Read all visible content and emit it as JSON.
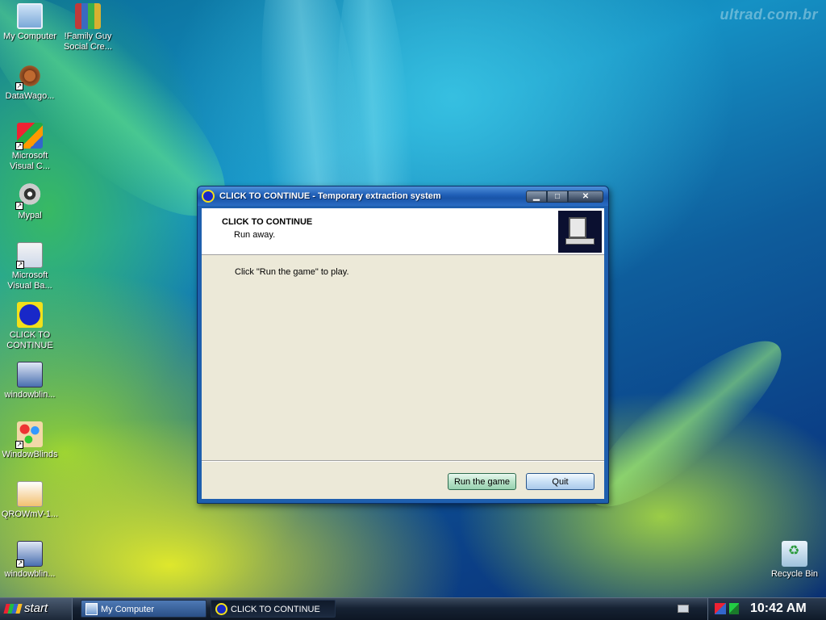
{
  "desktop": {
    "watermark": "ultrad.com.br",
    "icons": [
      {
        "label": "My Computer",
        "icon": "computer-icon"
      },
      {
        "label": "!Family Guy Social Cre...",
        "icon": "winrar-archive-icon"
      },
      {
        "label": "DataWago...",
        "icon": "gear-icon"
      },
      {
        "label": "Microsoft Visual C...",
        "icon": "visual-c-icon"
      },
      {
        "label": "Mypal",
        "icon": "raccoon-browser-icon"
      },
      {
        "label": "Microsoft Visual Ba...",
        "icon": "visual-basic-icon"
      },
      {
        "label": "CLICK TO CONTINUE",
        "icon": "click-to-continue-icon"
      },
      {
        "label": "windowblin...",
        "icon": "windowblinds-installer-icon"
      },
      {
        "label": "WindowBlinds",
        "icon": "paint-palette-icon"
      },
      {
        "label": "QROWmV-1...",
        "icon": "image-file-icon"
      },
      {
        "label": "windowblin...",
        "icon": "windowblinds-installer-icon"
      },
      {
        "label": "Recycle Bin",
        "icon": "recycle-bin-icon"
      }
    ]
  },
  "dialog": {
    "title": "CLICK TO CONTINUE - Temporary extraction system",
    "header_title": "CLICK TO CONTINUE",
    "header_subtitle": "Run away.",
    "body_text": "Click \"Run the game\" to play.",
    "buttons": {
      "run": "Run the game",
      "quit": "Quit"
    },
    "title_buttons": {
      "minimize": "▁",
      "maximize": "□",
      "close": "✕"
    }
  },
  "taskbar": {
    "start_label": "start",
    "tasks": [
      "My Computer",
      "CLICK TO CONTINUE"
    ],
    "clock": "10:42 AM"
  }
}
